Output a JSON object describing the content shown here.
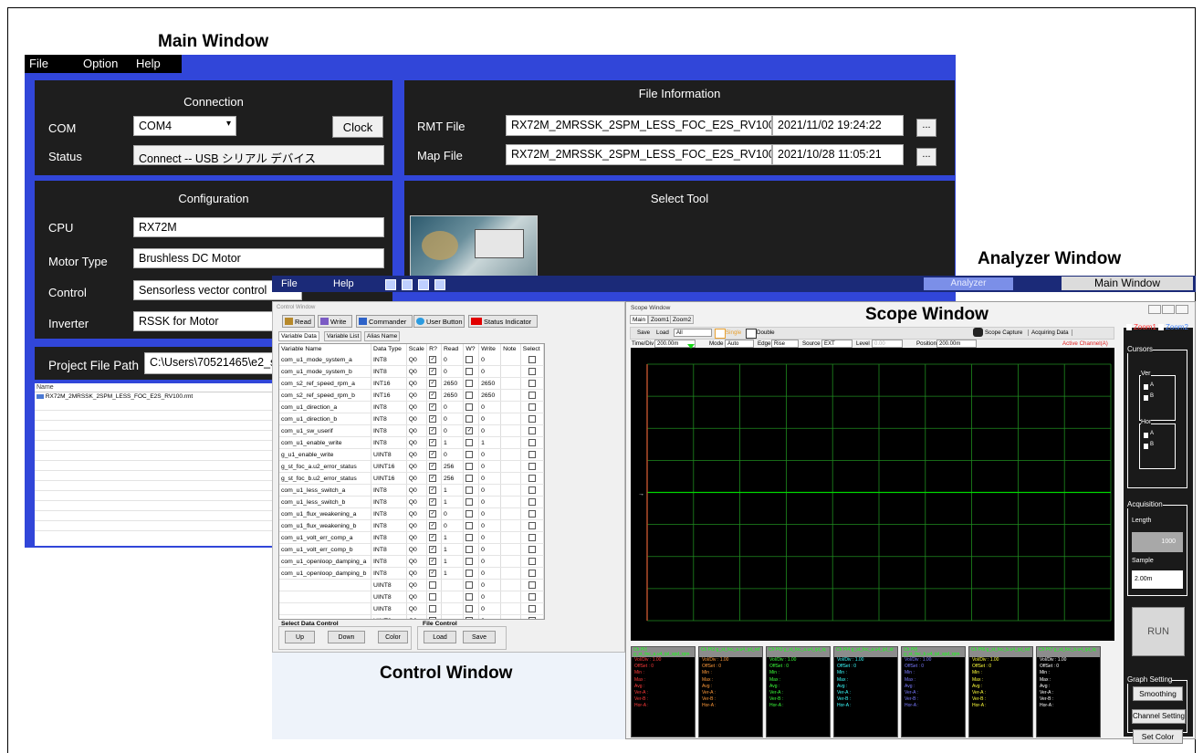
{
  "captions": {
    "main": "Main Window",
    "analyzer": "Analyzer Window",
    "scope": "Scope Window",
    "control": "Control Window"
  },
  "main_window": {
    "menu": [
      "File",
      "Option",
      "Help"
    ],
    "connection": {
      "title": "Connection",
      "com_label": "COM",
      "com_value": "COM4",
      "clock_button": "Clock",
      "status_label": "Status",
      "status_value": "Connect -- USB シリアル デバイス"
    },
    "file_info": {
      "title": "File Information",
      "rmt_label": "RMT File",
      "rmt_value": "RX72M_2MRSSK_2SPM_LESS_FOC_E2S_RV100....",
      "rmt_date": "2021/11/02 19:24:22",
      "map_label": "Map File",
      "map_value": "RX72M_2MRSSK_2SPM_LESS_FOC_E2S_RV100....",
      "map_date": "2021/10/28 11:05:21",
      "browse": "..."
    },
    "configuration": {
      "title": "Configuration",
      "cpu_label": "CPU",
      "cpu_value": "RX72M",
      "motor_label": "Motor Type",
      "motor_value": "Brushless DC Motor",
      "control_label": "Control",
      "control_value": "Sensorless vector control",
      "inverter_label": "Inverter",
      "inverter_value": "RSSK for Motor"
    },
    "select_tool": {
      "title": "Select Tool"
    },
    "project": {
      "label": "Project File Path",
      "value": "C:\\Users\\70521465\\e2_stu"
    },
    "file_list": {
      "header": "Name",
      "items": [
        "RX72M_2MRSSK_2SPM_LESS_FOC_E2S_RV100.rmt"
      ]
    }
  },
  "analyzer_bar": {
    "menu": [
      "File",
      "Help"
    ],
    "analyzer_button": "Analyzer",
    "main_window_button": "Main Window"
  },
  "control_window": {
    "title": "Control Window",
    "toolbar": [
      "Read",
      "Write",
      "Commander",
      "User Button",
      "Status Indicator"
    ],
    "tabs": [
      "Variable Data",
      "Variable List",
      "Alias Name"
    ],
    "columns": [
      "Variable Name",
      "Data Type",
      "Scale",
      "R?",
      "Read",
      "W?",
      "Write",
      "Note",
      "Select"
    ],
    "rows": [
      {
        "name": "com_u1_mode_system_a",
        "type": "INT8",
        "scale": "Q0",
        "r": true,
        "read": "0",
        "w": false,
        "write": "0"
      },
      {
        "name": "com_u1_mode_system_b",
        "type": "INT8",
        "scale": "Q0",
        "r": true,
        "read": "0",
        "w": false,
        "write": "0"
      },
      {
        "name": "com_s2_ref_speed_rpm_a",
        "type": "INT16",
        "scale": "Q0",
        "r": true,
        "read": "2650",
        "w": false,
        "write": "2650"
      },
      {
        "name": "com_s2_ref_speed_rpm_b",
        "type": "INT16",
        "scale": "Q0",
        "r": true,
        "read": "2650",
        "w": false,
        "write": "2650"
      },
      {
        "name": "com_u1_direction_a",
        "type": "INT8",
        "scale": "Q0",
        "r": true,
        "read": "0",
        "w": false,
        "write": "0"
      },
      {
        "name": "com_u1_direction_b",
        "type": "INT8",
        "scale": "Q0",
        "r": true,
        "read": "0",
        "w": false,
        "write": "0"
      },
      {
        "name": "com_u1_sw_userif",
        "type": "INT8",
        "scale": "Q0",
        "r": true,
        "read": "0",
        "w": true,
        "write": "0"
      },
      {
        "name": "com_u1_enable_write",
        "type": "INT8",
        "scale": "Q0",
        "r": true,
        "read": "1",
        "w": false,
        "write": "1"
      },
      {
        "name": "g_u1_enable_write",
        "type": "UINT8",
        "scale": "Q0",
        "r": true,
        "read": "0",
        "w": false,
        "write": "0"
      },
      {
        "name": "g_st_foc_a.u2_error_status",
        "type": "UINT16",
        "scale": "Q0",
        "r": true,
        "read": "256",
        "w": false,
        "write": "0"
      },
      {
        "name": "g_st_foc_b.u2_error_status",
        "type": "UINT16",
        "scale": "Q0",
        "r": true,
        "read": "256",
        "w": false,
        "write": "0"
      },
      {
        "name": "com_u1_less_switch_a",
        "type": "INT8",
        "scale": "Q0",
        "r": true,
        "read": "1",
        "w": false,
        "write": "0"
      },
      {
        "name": "com_u1_less_switch_b",
        "type": "INT8",
        "scale": "Q0",
        "r": true,
        "read": "1",
        "w": false,
        "write": "0"
      },
      {
        "name": "com_u1_flux_weakening_a",
        "type": "INT8",
        "scale": "Q0",
        "r": true,
        "read": "0",
        "w": false,
        "write": "0"
      },
      {
        "name": "com_u1_flux_weakening_b",
        "type": "INT8",
        "scale": "Q0",
        "r": true,
        "read": "0",
        "w": false,
        "write": "0"
      },
      {
        "name": "com_u1_volt_err_comp_a",
        "type": "INT8",
        "scale": "Q0",
        "r": true,
        "read": "1",
        "w": false,
        "write": "0"
      },
      {
        "name": "com_u1_volt_err_comp_b",
        "type": "INT8",
        "scale": "Q0",
        "r": true,
        "read": "1",
        "w": false,
        "write": "0"
      },
      {
        "name": "com_u1_openloop_damping_a",
        "type": "INT8",
        "scale": "Q0",
        "r": true,
        "read": "1",
        "w": false,
        "write": "0"
      },
      {
        "name": "com_u1_openloop_damping_b",
        "type": "INT8",
        "scale": "Q0",
        "r": true,
        "read": "1",
        "w": false,
        "write": "0"
      },
      {
        "name": "",
        "type": "UINT8",
        "scale": "Q0",
        "r": false,
        "read": "",
        "w": false,
        "write": "0"
      },
      {
        "name": "",
        "type": "UINT8",
        "scale": "Q0",
        "r": false,
        "read": "",
        "w": false,
        "write": "0"
      },
      {
        "name": "",
        "type": "UINT8",
        "scale": "Q0",
        "r": false,
        "read": "",
        "w": false,
        "write": "0"
      },
      {
        "name": "",
        "type": "UINT8",
        "scale": "Q0",
        "r": false,
        "read": "",
        "w": false,
        "write": "0"
      }
    ],
    "select_group": {
      "title": "Select Data Control",
      "buttons": [
        "Up",
        "Down",
        "Color"
      ]
    },
    "file_group": {
      "title": "File Control",
      "buttons": [
        "Load",
        "Save"
      ]
    }
  },
  "scope_window": {
    "title": "Scope Window",
    "tabs": [
      "Main",
      "Zoom1",
      "Zoom2"
    ],
    "toolbar": {
      "save": "Save",
      "load": "Load",
      "load_value": "All",
      "single": "Single",
      "double": "Double",
      "capture": "Scope Capture",
      "acquiring": "Acquiring Data"
    },
    "params": {
      "time_div_label": "Time/Div",
      "time_div_value": "200.00m",
      "mode_label": "Mode",
      "mode_value": "Auto",
      "edge_label": "Edge",
      "edge_value": "Rise",
      "source_label": "Source",
      "source_value": "EXT",
      "level_label": "Level",
      "level_value": "0.00",
      "position_label": "Position",
      "position_value": "200.00m",
      "active_channel": "Active Channel(A)"
    },
    "channels": [
      {
        "head": "Ch Pt1 g_st_foc_a.u4_ipl_spd_rpm",
        "color": "#ff3a3a",
        "lines": [
          "Vol/Div : 1.00",
          "OffSet : 0",
          "Min :",
          "Max :",
          "Avg :",
          "Ver-A :",
          "Ver-B :",
          "Hor-A :"
        ]
      },
      {
        "head": "Ch Pt2 g_st_foc_a.u4_ipl_ref",
        "color": "#ff9a3a",
        "lines": [
          "Vol/Div : 1.00",
          "OffSet : 0",
          "Min :",
          "Max :",
          "Avg :",
          "Ver-A :",
          "Ver-B :",
          "Hor-A :"
        ]
      },
      {
        "head": "Ch Pt3 g_st_foc_a.u4_ipl_iq",
        "color": "#3aff3a",
        "lines": [
          "Vol/Div : 1.00",
          "OffSet : 0",
          "Min :",
          "Max :",
          "Avg :",
          "Ver-A :",
          "Ver-B :",
          "Hor-A :"
        ]
      },
      {
        "head": "Ch Pt4 g_st_foc_a.u4_ipl_id",
        "color": "#3affff",
        "lines": [
          "Vol/Div : 1.00",
          "OffSet : 0",
          "Min :",
          "Max :",
          "Avg :",
          "Ver-A :",
          "Ver-B :",
          "Hor-A :"
        ]
      },
      {
        "head": "Ch Pt5 g_st_foc_b.u4_ipl_spd_rpm",
        "color": "#7a7aff",
        "lines": [
          "Vol/Div : 1.00",
          "OffSet : 0",
          "Min :",
          "Max :",
          "Avg :",
          "Ver-A :",
          "Ver-B :",
          "Hor-A :"
        ]
      },
      {
        "head": "Ch Pt6 g_st_foc_b.u4_ipl_ref",
        "color": "#ffff3a",
        "lines": [
          "Vol/Div : 1.00",
          "OffSet : 0",
          "Min :",
          "Max :",
          "Avg :",
          "Ver-A :",
          "Ver-B :",
          "Hor-A :"
        ]
      },
      {
        "head": "Ch Pt7 g_st_foc_b.u4_ipl_iq",
        "color": "#ffffff",
        "lines": [
          "Vol/Div : 1.00",
          "OffSet : 0",
          "Min :",
          "Max :",
          "Avg :",
          "Ver-A :",
          "Ver-B :",
          "Hor-A :"
        ]
      }
    ],
    "right_panel": {
      "zoom1": "Zoom1",
      "zoom2": "Zoom2",
      "cursors": "Cursors",
      "ver": "Ver",
      "hor": "Hor",
      "a": "A",
      "b": "B",
      "acquisition": "Acquisition",
      "length": "Length",
      "length_value": "1000",
      "sample": "Sample",
      "sample_value": "2.00m",
      "run": "RUN",
      "graph_setting": "Graph Setting",
      "smoothing": "Smoothing",
      "channel_setting": "Channel Setting",
      "set_color": "Set Color"
    }
  },
  "colors": {
    "main_bg": "#3146d9",
    "panel": "#1e1e1e",
    "bar": "#1b2a78",
    "grid": "#1f8a1f",
    "trace": "#00d800"
  }
}
